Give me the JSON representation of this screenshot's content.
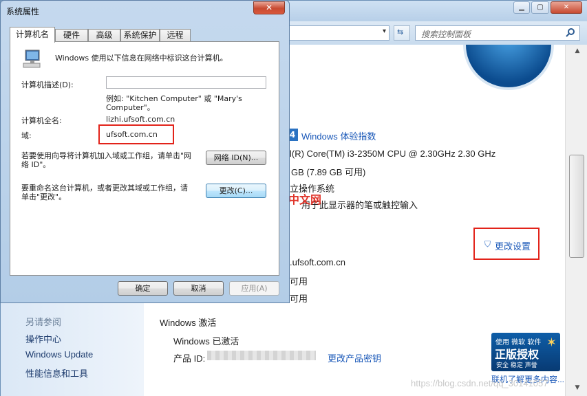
{
  "dialog": {
    "title": "系统属性",
    "close_label": "✕",
    "tabs": [
      "计算机名",
      "硬件",
      "高级",
      "系统保护",
      "远程"
    ],
    "intro": "Windows 使用以下信息在网络中标识这台计算机。",
    "desc_label": "计算机描述(D):",
    "desc_value": "",
    "example": "例如: \"Kitchen Computer\" 或 \"Mary's Computer\"。",
    "fullname_label": "计算机全名:",
    "fullname_value": "lizhi.ufsoft.com.cn",
    "domain_label": "域:",
    "domain_value": "ufsoft.com.cn",
    "network_text": "若要使用向导将计算机加入域或工作组，请单击\"网络 ID\"。",
    "network_button": "网络 ID(N)...",
    "rename_text": "要重命名这台计算机，或者更改其域或工作组，请单击\"更改\"。",
    "change_button": "更改(C)...",
    "ok_button": "确定",
    "cancel_button": "取消",
    "apply_button": "应用(A)"
  },
  "background": {
    "search_placeholder": "搜索控制面板",
    "experience_index": "Windows 体验指数",
    "score": "4",
    "processor": "l(R) Core(TM) i3-2350M CPU @ 2.30GHz   2.30 GHz",
    "memory": "GB (7.89 GB 可用)",
    "os_type": "立操作系统",
    "pen": "用于此显示器的笔或触控输入",
    "change_settings": "更改设置",
    "domain_line": ".ufsoft.com.cn",
    "avail1": "可用",
    "avail2": "可用",
    "activation_heading": "Windows 激活",
    "activated": "Windows 已激活",
    "product_id_label": "产品 ID:",
    "change_key": "更改产品密钥",
    "learn_more": "联机了解更多内容...",
    "genuine_top": "使用 微软 软件",
    "genuine_main": "正版授权",
    "genuine_bottom": "安全 稳定 声誉",
    "see_also": "另请参阅",
    "left_links": [
      "操作中心",
      "Windows Update",
      "性能信息和工具"
    ],
    "php_logo": "php",
    "php_text": "中文网",
    "watermark": "https://blog.csdn.net/qq_30141057"
  }
}
